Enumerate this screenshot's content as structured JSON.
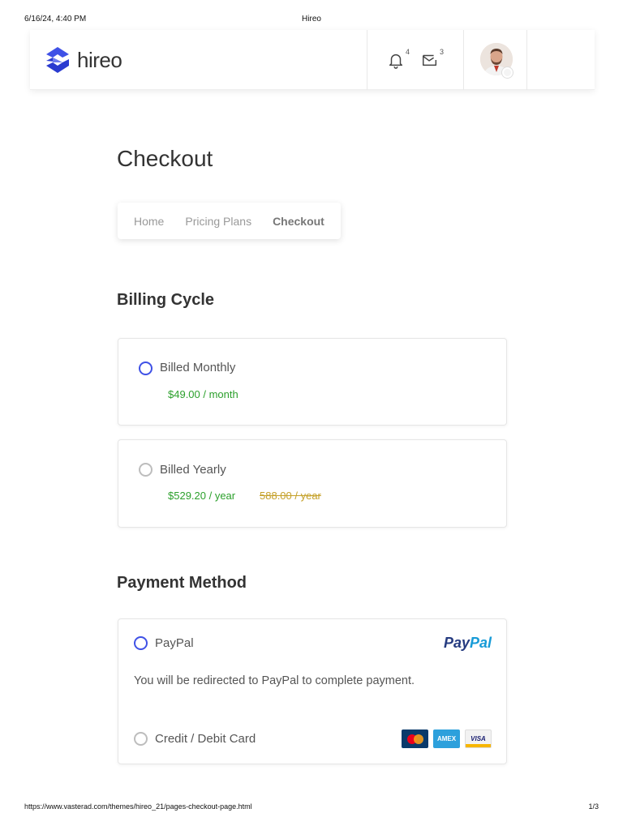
{
  "print": {
    "datetime": "6/16/24, 4:40 PM",
    "doc_title": "Hireo",
    "url": "https://www.vasterad.com/themes/hireo_21/pages-checkout-page.html",
    "page": "1/3"
  },
  "header": {
    "brand": "hireo",
    "notifications_count": "4",
    "messages_count": "3"
  },
  "page": {
    "title": "Checkout",
    "breadcrumb": [
      "Home",
      "Pricing Plans",
      "Checkout"
    ]
  },
  "billing": {
    "title": "Billing Cycle",
    "monthly": {
      "label": "Billed Monthly",
      "price": "$49.00 / month",
      "selected": true
    },
    "yearly": {
      "label": "Billed Yearly",
      "price": "$529.20 / year",
      "old_price": "588.00 / year",
      "selected": false
    }
  },
  "payment": {
    "title": "Payment Method",
    "paypal": {
      "label": "PayPal",
      "logo_pay": "Pay",
      "logo_pal": "Pal",
      "note": "You will be redirected to PayPal to complete payment.",
      "selected": true
    },
    "card": {
      "label": "Credit / Debit Card",
      "logos": [
        "MasterCard",
        "AMEX",
        "VISA"
      ],
      "selected": false
    }
  },
  "colors": {
    "accent": "#3f51e6",
    "price_green": "#2ca02c",
    "strike_gold": "#c5a12a"
  }
}
